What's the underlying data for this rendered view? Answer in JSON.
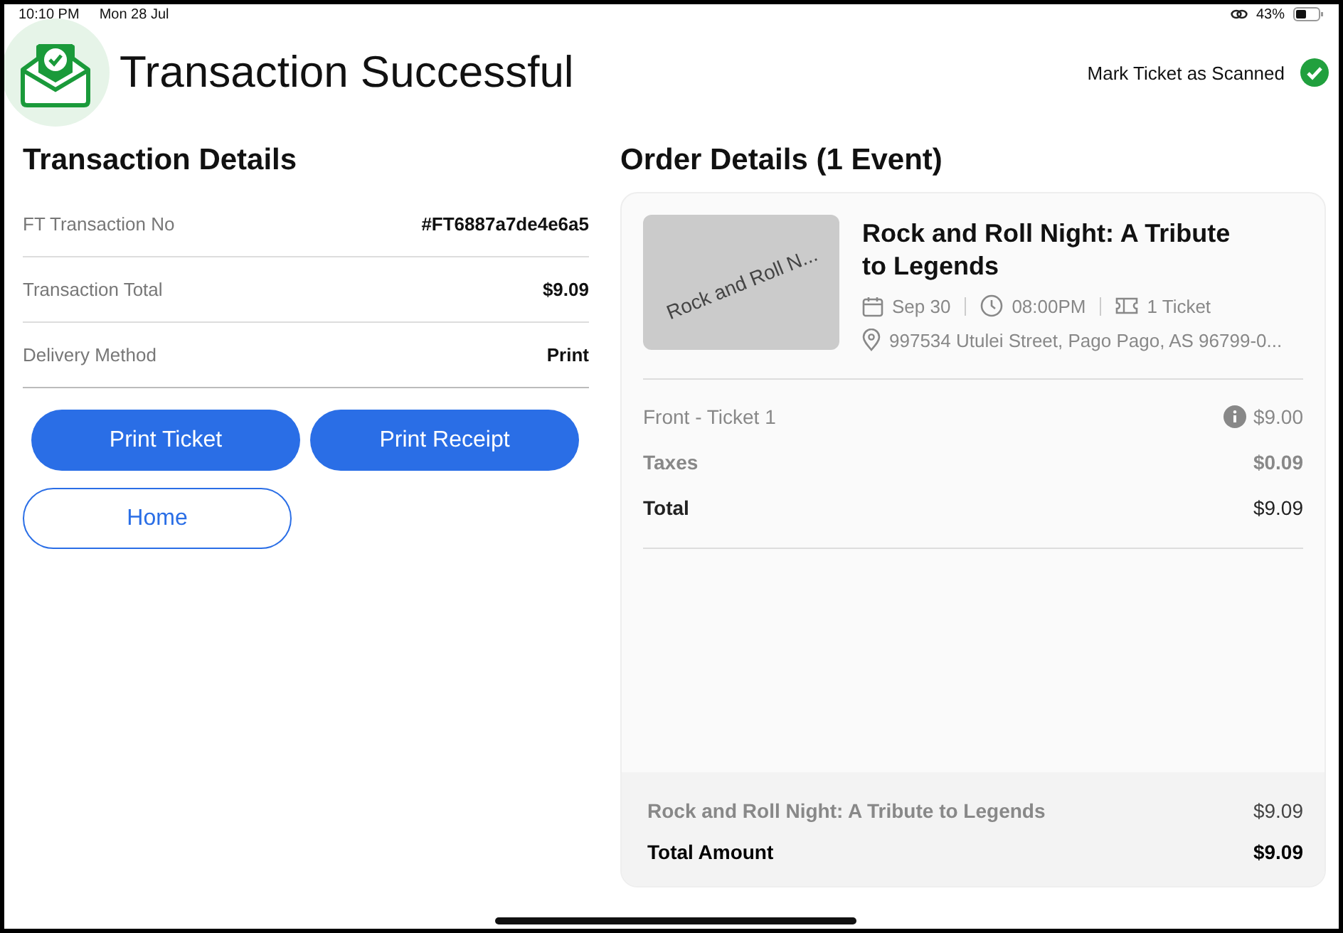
{
  "status_bar": {
    "time": "10:10 PM",
    "date": "Mon 28 Jul",
    "battery": "43%"
  },
  "header": {
    "title": "Transaction Successful",
    "mark_scanned": {
      "label": "Mark Ticket as Scanned",
      "checked": true
    }
  },
  "transaction": {
    "heading": "Transaction Details",
    "rows": [
      {
        "label": "FT Transaction No",
        "value": "#FT6887a7de4e6a5"
      },
      {
        "label": "Transaction Total",
        "value": "$9.09"
      },
      {
        "label": "Delivery Method",
        "value": "Print"
      }
    ],
    "buttons": [
      {
        "label": "Print Ticket",
        "kind": "filled"
      },
      {
        "label": "Print Receipt",
        "kind": "filled"
      },
      {
        "label": "Home",
        "kind": "outline"
      }
    ]
  },
  "order": {
    "heading": "Order Details (1 Event)",
    "event": {
      "image_text": "Rock and Roll N...",
      "title": "Rock and Roll Night: A Tribute to Legends",
      "date": "Sep 30",
      "time": "08:00PM",
      "tickets": "1 Ticket",
      "address": "997534 Utulei Street, Pago Pago, AS 96799-0..."
    },
    "lines": [
      {
        "label": "Front - Ticket 1",
        "value": "$9.00",
        "kind": "item"
      },
      {
        "label": "Taxes",
        "value": "$0.09",
        "kind": "tax"
      },
      {
        "label": "Total",
        "value": "$9.09",
        "kind": "total"
      }
    ],
    "summary": [
      {
        "label": "Rock and Roll Night: A Tribute to Legends",
        "value": "$9.09",
        "kind": "item"
      },
      {
        "label": "Total Amount",
        "value": "$9.09",
        "kind": "total"
      }
    ]
  }
}
